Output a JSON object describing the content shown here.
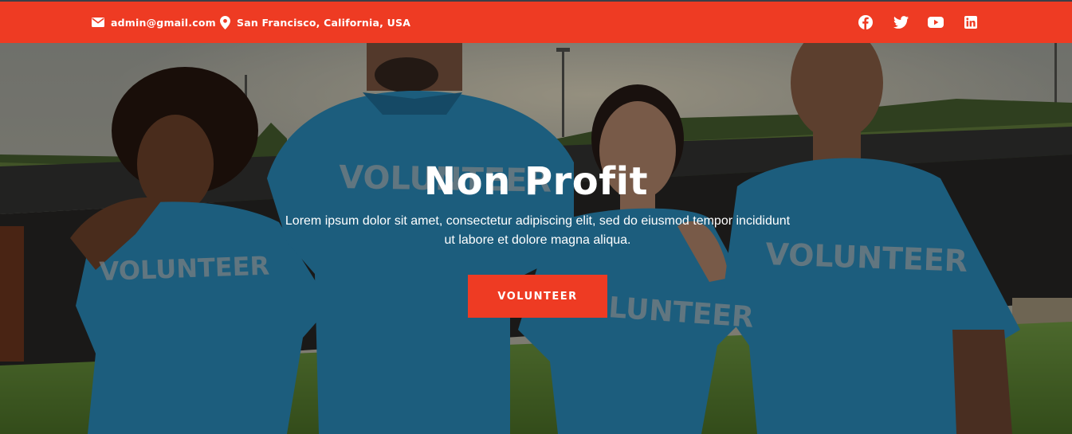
{
  "topbar": {
    "email": "admin@gmail.com",
    "location": "San Francisco, California, USA",
    "socials": [
      {
        "icon": "facebook-icon"
      },
      {
        "icon": "twitter-icon"
      },
      {
        "icon": "youtube-icon"
      },
      {
        "icon": "linkedin-icon"
      }
    ]
  },
  "hero": {
    "title": "Non Profit",
    "subtitle": "Lorem ipsum dolor sit amet, consectetur adipiscing elit, sed do eiusmod tempor incididunt ut labore et dolore magna aliqua.",
    "button_label": "VOLUNTEER",
    "shirt_text": "VOLUNTEER"
  },
  "colors": {
    "accent": "#ee3b23",
    "shirt": "#2f9bd0",
    "text": "#ffffff"
  }
}
